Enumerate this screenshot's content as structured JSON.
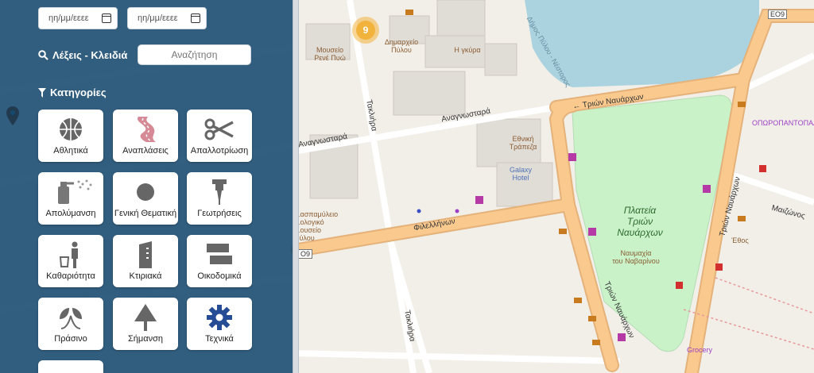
{
  "filters": {
    "date_from_placeholder": "ηη/μμ/εεεε",
    "date_to_placeholder": "ηη/μμ/εεεε",
    "keywords_label": "Λέξεις - Κλειδιά",
    "search_placeholder": "Αναζήτηση",
    "categories_label": "Κατηγορίες"
  },
  "categories": [
    {
      "label": "Αθλητικά",
      "icon": "basketball-icon"
    },
    {
      "label": "Αναπλάσεις",
      "icon": "road-icon"
    },
    {
      "label": "Απαλλοτρίωση",
      "icon": "scissors-icon"
    },
    {
      "label": "Απολύμανση",
      "icon": "spray-icon"
    },
    {
      "label": "Γενική Θεματική",
      "icon": "circle-icon"
    },
    {
      "label": "Γεωτρήσεις",
      "icon": "drill-icon"
    },
    {
      "label": "Καθαριότητα",
      "icon": "trash-person-icon"
    },
    {
      "label": "Κτιριακά",
      "icon": "building-icon"
    },
    {
      "label": "Οικοδομικά",
      "icon": "bricks-icon"
    },
    {
      "label": "Πράσινο",
      "icon": "leaves-icon"
    },
    {
      "label": "Σήμανση",
      "icon": "sign-icon"
    },
    {
      "label": "Τεχνικά",
      "icon": "gear-icon"
    }
  ],
  "map": {
    "cluster_count": "9",
    "streets": {
      "trion_navarhon_top": "← Τριών Ναυάρχων",
      "anagnostara": "Αναγνωσταρά",
      "anagnostara_left": "Αναγνωσταρά",
      "takliara_top": "Τακλιήρα",
      "takliara_bottom": "Τακλιήρα",
      "filellinon": "Φιλελλήνων",
      "trion_navarhon_right": "Τριών Ναυάρχων",
      "trion_navarhon_bottom": "Τριών Ναυάρχων",
      "maizonos": "Μαιζώνος",
      "dimos_pylou": "Δήμος Πύλου - Νέστορος",
      "e09_top": "EO9",
      "e09_left": "O9"
    },
    "square_name": "Πλατεία\nΤριών Ναυάρχων",
    "pois": {
      "museum": "Μουσείο\nΡενέ Πυώ",
      "town_hall": "Δημαρχείο\nΠύλου",
      "igkyra": "Η γκύρα",
      "bank": "Εθνική\nΤράπεζα",
      "hotel": "Galaxy\nHotel",
      "museum2": "...ασπαμύλειο\n...ολογικό\n...ουσείο\nΠύλου",
      "monument": "Ναυμαχία\nτου Ναβαρίνου",
      "ethos": "Έθος",
      "grocery": "Grocery",
      "opoporopoleio": "ΟΠΩΡΟΠΑΝΤΟΠΑΛΕΙ"
    }
  },
  "colors": {
    "panel": "#16496e",
    "road_major": "#f9c98e",
    "park": "#c9f2c9",
    "water": "#aad3df",
    "cluster": "#f2b33d"
  }
}
